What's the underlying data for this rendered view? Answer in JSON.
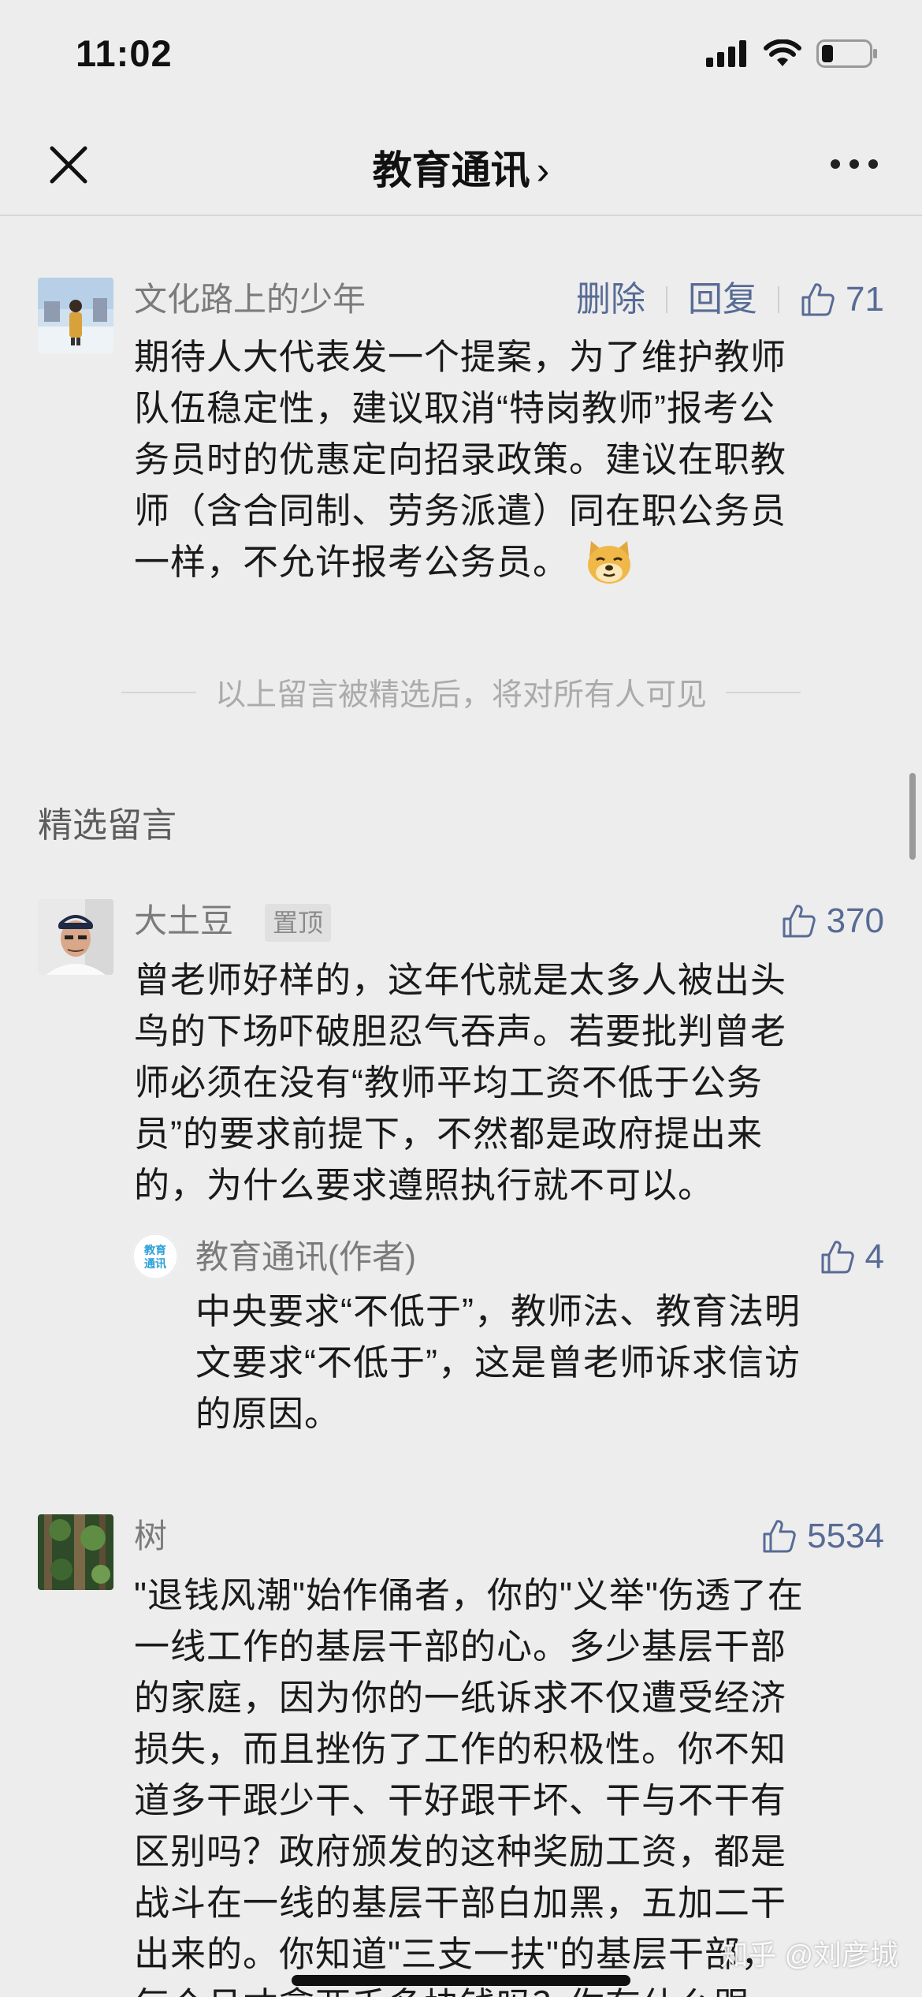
{
  "status_bar": {
    "time": "11:02",
    "icons": [
      "cellular-signal-icon",
      "wifi-icon",
      "battery-icon"
    ]
  },
  "nav": {
    "title": "教育通讯",
    "chevron": "›",
    "close_icon": "close-icon",
    "more_icon": "more-icon"
  },
  "my_comment": {
    "name": "文化路上的少年",
    "delete_label": "删除",
    "reply_label": "回复",
    "likes": "71",
    "lines": [
      "期待人大代表发一个提案，为了维护教师",
      "队伍稳定性，建议取消“特岗教师”报考公",
      "务员时的优惠定向招录政策。建议在职教",
      "师（含合同制、劳务派遣）同在职公务员",
      "一样，不允许报考公务员。"
    ]
  },
  "divider_text": "以上留言被精选后，将对所有人可见",
  "section_title": "精选留言",
  "featured": [
    {
      "name": "大土豆",
      "pin": "置顶",
      "likes": "370",
      "lines": [
        "曾老师好样的，这年代就是太多人被出头",
        "鸟的下场吓破胆忍气吞声。若要批判曾老",
        "师必须在没有“教师平均工资不低于公务",
        "员”的要求前提下，不然都是政府提出来",
        "的，为什么要求遵照执行就不可以。"
      ],
      "reply": {
        "logo_text": [
          "教育",
          "通讯"
        ],
        "name": "教育通讯(作者)",
        "likes": "4",
        "lines": [
          "中央要求“不低于”，教师法、教育法明",
          "文要求“不低于”，这是曾老师诉求信访",
          "的原因。"
        ]
      }
    },
    {
      "name": "树",
      "likes": "5534",
      "lines": [
        "\"退钱风潮\"始作俑者，你的\"义举\"伤透了在",
        "一线工作的基层干部的心。多少基层干部",
        "的家庭，因为你的一纸诉求不仅遭受经济",
        "损失，而且挫伤了工作的积极性。你不知",
        "道多干跟少干、干好跟干坏、干与不干有",
        "区别吗？政府颁发的这种奖励工资，都是",
        "战斗在一线的基层干部白加黑，五加二干",
        "出来的。你知道\"三支一扶\"的基层干部，",
        "每个月才拿两千多块钱吗？你有什么跟"
      ]
    }
  ],
  "watermark": "知乎 @刘彦城",
  "colors": {
    "background": "#ededed",
    "link": "#576b95",
    "text": "#1a1a1a",
    "meta": "#7b7b7b"
  }
}
